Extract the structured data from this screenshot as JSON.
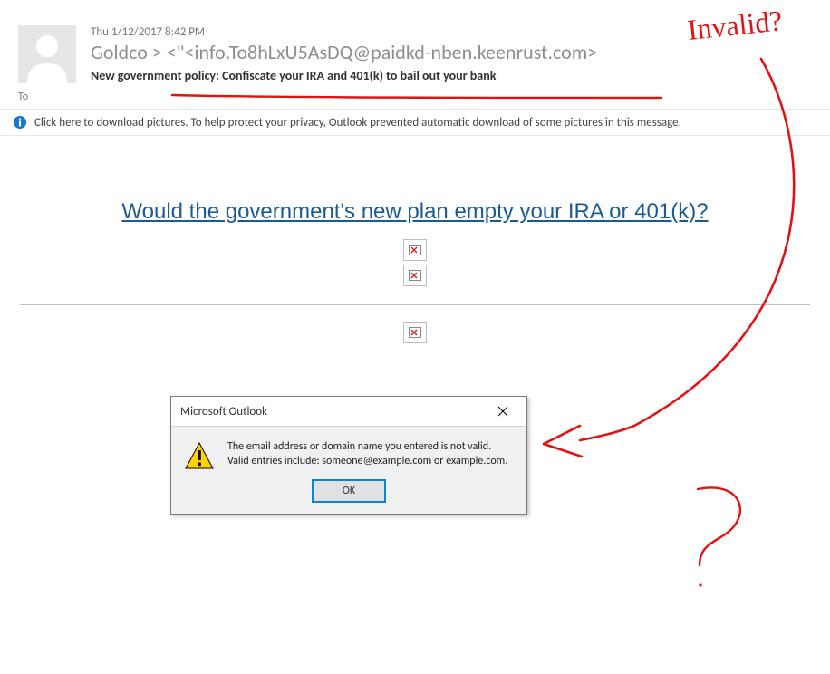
{
  "header": {
    "timestamp": "Thu 1/12/2017 8:42 PM",
    "sender_display": "Goldco > <\"<info.To8hLxU5AsDQ@paidkd-nben.keenrust.com>",
    "subject": "New government policy: Confiscate your IRA and 401(k) to bail out your bank",
    "to_label": "To"
  },
  "infobar": {
    "text": "Click here to download pictures. To help protect your privacy, Outlook prevented automatic download of some pictures in this message."
  },
  "body": {
    "headline_link": "Would the government's new plan empty your IRA or 401(k)?"
  },
  "dialog": {
    "title": "Microsoft Outlook",
    "line1": "The email address or domain name you entered is not valid.",
    "line2": "Valid entries include: someone@example.com or example.com.",
    "ok_label": "OK"
  },
  "annotations": {
    "invalid_label": "Invalid?"
  }
}
